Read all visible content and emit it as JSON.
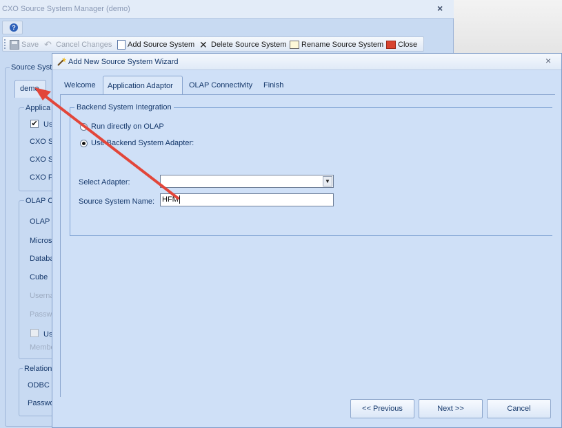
{
  "main_window": {
    "title": "CXO Source System Manager (demo)",
    "close_glyph": "×",
    "toolbar": {
      "save": "Save",
      "cancel_changes": "Cancel Changes",
      "add_source_system": "Add Source System",
      "delete_source_system": "Delete Source System",
      "rename_source_system": "Rename Source System",
      "close": "Close"
    },
    "help_glyph": "?",
    "source_system_group": "Source Syst",
    "tab": "demo",
    "fragments": {
      "application_group": "Applica",
      "use_check_label": "Us",
      "cxo_s1": "CXO S",
      "cxo_s2": "CXO S",
      "cxo_f": "CXO F",
      "olap_group": "OLAP C",
      "olap": "OLAP",
      "micros": "Micros",
      "databa": "Databa",
      "cube": "Cube",
      "userna": "Userna",
      "passw": "Passw",
      "use2": "Us",
      "membe": "Membe",
      "relation_group": "Relation",
      "odbc": "ODBC",
      "passwo": "Passwo"
    }
  },
  "dialog": {
    "title": "Add New Source System Wizard",
    "close_glyph": "×",
    "tabs": [
      "Welcome",
      "Application Adaptor",
      "OLAP Connectivity",
      "Finish"
    ],
    "active_tab": "Application Adaptor",
    "group_title": "Backend System Integration",
    "radio_olap": "Run directly on OLAP",
    "radio_adapter": "Use Backend System Adapter:",
    "select_adapter_label": "Select Adapter:",
    "select_adapter_value": "",
    "source_system_name_label": "Source System Name:",
    "source_system_name_value": "HFM",
    "buttons": {
      "previous": "<< Previous",
      "next": "Next >>",
      "cancel": "Cancel"
    }
  },
  "colors": {
    "annotation_arrow": "#e2463a",
    "dialog_bg": "#cfe0f7",
    "text": "#15386b"
  }
}
